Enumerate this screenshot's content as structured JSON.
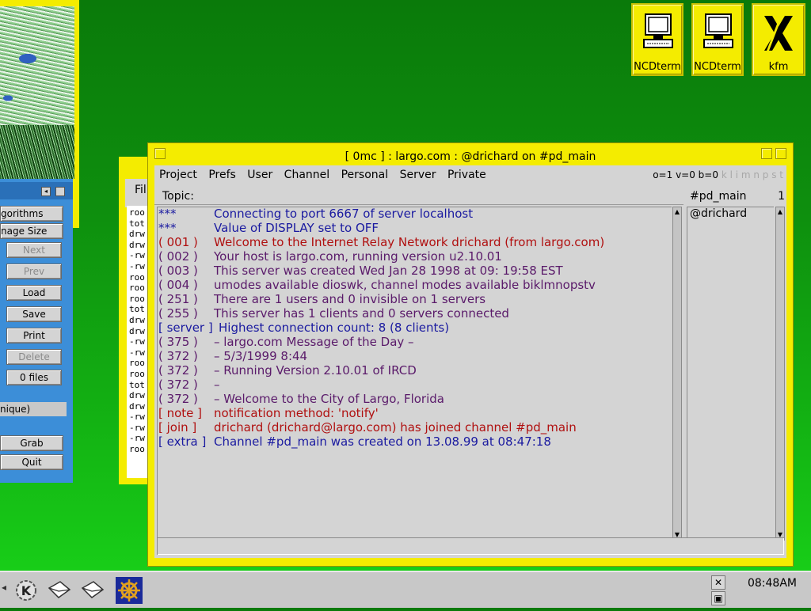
{
  "desktop_icons": [
    {
      "label": "NCDterm",
      "icon": "terminal-icon"
    },
    {
      "label": "NCDterm",
      "icon": "terminal-icon"
    },
    {
      "label": "kfm",
      "icon": "x-icon"
    }
  ],
  "control_panel": {
    "algorithms": "gorithms",
    "image_size": "nage Size",
    "buttons": [
      "Next",
      "Prev",
      "Load",
      "Save",
      "Print",
      "Delete",
      "0 files"
    ],
    "unique_label": "nique)",
    "grab": "Grab",
    "quit": "Quit"
  },
  "file_manager": {
    "menu_fragment": "Fil",
    "rows": [
      "roo",
      "tot",
      "drw",
      "drw",
      "-rw",
      "-rw",
      "roo",
      "roo",
      "roo",
      "tot",
      "drw",
      "drw",
      "-rw",
      "-rw",
      "roo",
      "roo",
      "tot",
      "drw",
      "drw",
      "-rw",
      "-rw",
      "-rw",
      "roo"
    ]
  },
  "irc": {
    "title": "[ 0mc ] : largo.com : @drichard on #pd_main",
    "menu": [
      "Project",
      "Prefs",
      "User",
      "Channel",
      "Personal",
      "Server",
      "Private"
    ],
    "modes_active": "o=1 v=0 b=0",
    "modes_dim": "k l i m n p s t",
    "topic_label": "Topic:",
    "channel": "#pd_main",
    "user_count": "1",
    "users": [
      "@drichard"
    ],
    "lines": [
      {
        "tag": "***",
        "msg": "Connecting to port 6667 of server localhost",
        "color": "#1a1aa0"
      },
      {
        "tag": "***",
        "msg": "Value of DISPLAY set to OFF",
        "color": "#1a1aa0"
      },
      {
        "tag": "( 001 )",
        "msg": "Welcome to the Internet Relay Network drichard (from largo.com)",
        "color": "#b01010"
      },
      {
        "tag": "( 002 )",
        "msg": "Your host is largo.com, running version u2.10.01",
        "color": "#5a1a6a"
      },
      {
        "tag": "( 003 )",
        "msg": "This server was created Wed Jan 28 1998 at 09: 19:58 EST",
        "color": "#5a1a6a"
      },
      {
        "tag": "( 004 )",
        "msg": "umodes available dioswk, channel modes available biklmnopstv",
        "color": "#5a1a6a"
      },
      {
        "tag": "( 251 )",
        "msg": "There are 1 users and 0 invisible on 1 servers",
        "color": "#5a1a6a"
      },
      {
        "tag": "( 255 )",
        "msg": "This server has 1 clients and 0 servers connected",
        "color": "#5a1a6a"
      },
      {
        "tag": "[ server ]",
        "msg": "Highest connection count: 8 (8 clients)",
        "color": "#1a1aa0",
        "full": true
      },
      {
        "tag": "( 375 )",
        "msg": "– largo.com Message of the Day –",
        "color": "#5a1a6a"
      },
      {
        "tag": "( 372 )",
        "msg": "– 5/3/1999 8:44",
        "color": "#5a1a6a"
      },
      {
        "tag": "( 372 )",
        "msg": "– Running Version 2.10.01 of IRCD",
        "color": "#5a1a6a"
      },
      {
        "tag": "( 372 )",
        "msg": "–",
        "color": "#5a1a6a"
      },
      {
        "tag": "( 372 )",
        "msg": "– Welcome to the City of Largo, Florida",
        "color": "#5a1a6a"
      },
      {
        "tag": "[ note ]",
        "msg": "notification method: 'notify'",
        "color": "#b01010"
      },
      {
        "tag": "[ join ]",
        "msg": "drichard (drichard@largo.com) has joined channel #pd_main",
        "color": "#b01010"
      },
      {
        "tag": "[ extra ]",
        "msg": "Channel #pd_main was created on 13.08.99 at 08:47:18",
        "color": "#1a1aa0"
      }
    ]
  },
  "taskbar": {
    "clock": "08:48AM"
  }
}
